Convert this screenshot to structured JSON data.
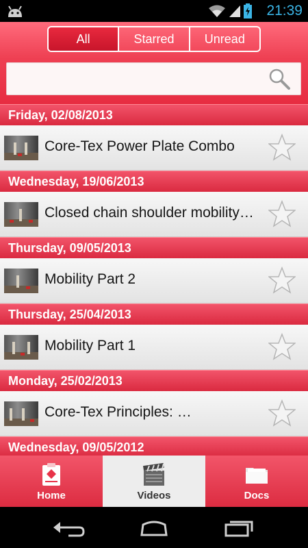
{
  "status_bar": {
    "time": "21:39",
    "icons": [
      "android-icon",
      "wifi-icon",
      "signal-icon",
      "battery-charging-icon"
    ]
  },
  "filter": {
    "tabs": [
      {
        "label": "All",
        "active": true
      },
      {
        "label": "Starred",
        "active": false
      },
      {
        "label": "Unread",
        "active": false
      }
    ]
  },
  "search": {
    "value": "",
    "placeholder": ""
  },
  "sections": [
    {
      "date": "Friday, 02/08/2013",
      "title": "Core-Tex Power Plate Combo",
      "starred": false
    },
    {
      "date": "Wednesday, 19/06/2013",
      "title": "Closed chain shoulder mobility…",
      "starred": false
    },
    {
      "date": "Thursday, 09/05/2013",
      "title": "Mobility Part 2",
      "starred": false
    },
    {
      "date": "Thursday, 25/04/2013",
      "title": "Mobility Part 1",
      "starred": false
    },
    {
      "date": "Monday, 25/02/2013",
      "title": "Core-Tex Principles: …",
      "starred": false
    },
    {
      "date": "Wednesday, 09/05/2012",
      "title": "",
      "starred": false
    }
  ],
  "bottom_nav": [
    {
      "label": "Home",
      "icon": "clipboard-icon",
      "active": false
    },
    {
      "label": "Videos",
      "icon": "clapperboard-icon",
      "active": true
    },
    {
      "label": "Docs",
      "icon": "folder-icon",
      "active": false
    }
  ],
  "colors": {
    "accent": "#e83349",
    "accent_light": "#ff6b7c",
    "clock": "#3bb5e6"
  }
}
